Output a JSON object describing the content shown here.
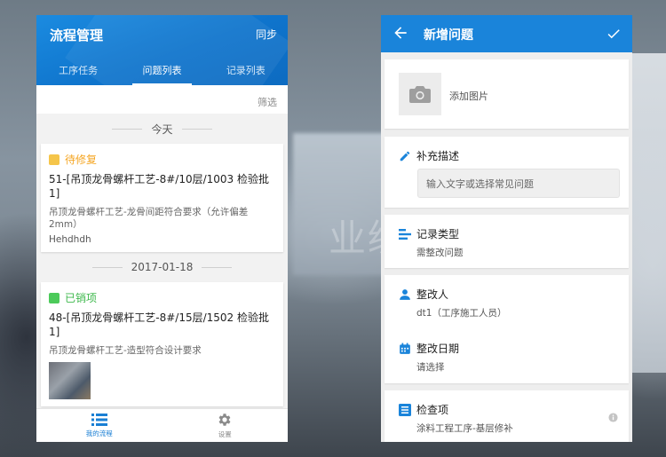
{
  "left": {
    "title": "流程管理",
    "sync_label": "同步",
    "tabs": [
      {
        "label": "工序任务"
      },
      {
        "label": "问题列表"
      },
      {
        "label": "记录列表"
      }
    ],
    "filter_label": "筛选",
    "groups": [
      {
        "date": "今天",
        "item": {
          "status": "待修复",
          "status_color": "#f5a623",
          "title": "51-[吊顶龙骨螺杆工艺-8#/10层/1003  检验批1]",
          "desc": "吊顶龙骨螺杆工艺-龙骨间距符合要求（允许偏差2mm）",
          "note": "Hehdhdh"
        }
      },
      {
        "date": "2017-01-18",
        "item": {
          "status": "已销项",
          "status_color": "#4cca5a",
          "title": "48-[吊顶龙骨螺杆工艺-8#/15层/1502  检验批1]",
          "desc": "吊顶龙骨螺杆工艺-造型符合设计要求"
        }
      }
    ],
    "bottom_nav": [
      {
        "label": "我的流程",
        "icon": "list-icon"
      },
      {
        "label": "设置",
        "icon": "gear-icon"
      }
    ],
    "accent": "#1a7fd4"
  },
  "right": {
    "title": "新增问题",
    "photo_label": "添加图片",
    "fields": {
      "desc": {
        "label": "补充描述",
        "placeholder": "输入文字或选择常见问题"
      },
      "type": {
        "label": "记录类型",
        "value": "需整改问题"
      },
      "person": {
        "label": "整改人",
        "value": "dt1（工序施工人员）"
      },
      "date": {
        "label": "整改日期",
        "value": "请选择"
      },
      "check": {
        "label": "检查项",
        "value": "涂料工程工序-基层修补"
      }
    },
    "accent": "#1a84da"
  },
  "background_text": "业级前"
}
